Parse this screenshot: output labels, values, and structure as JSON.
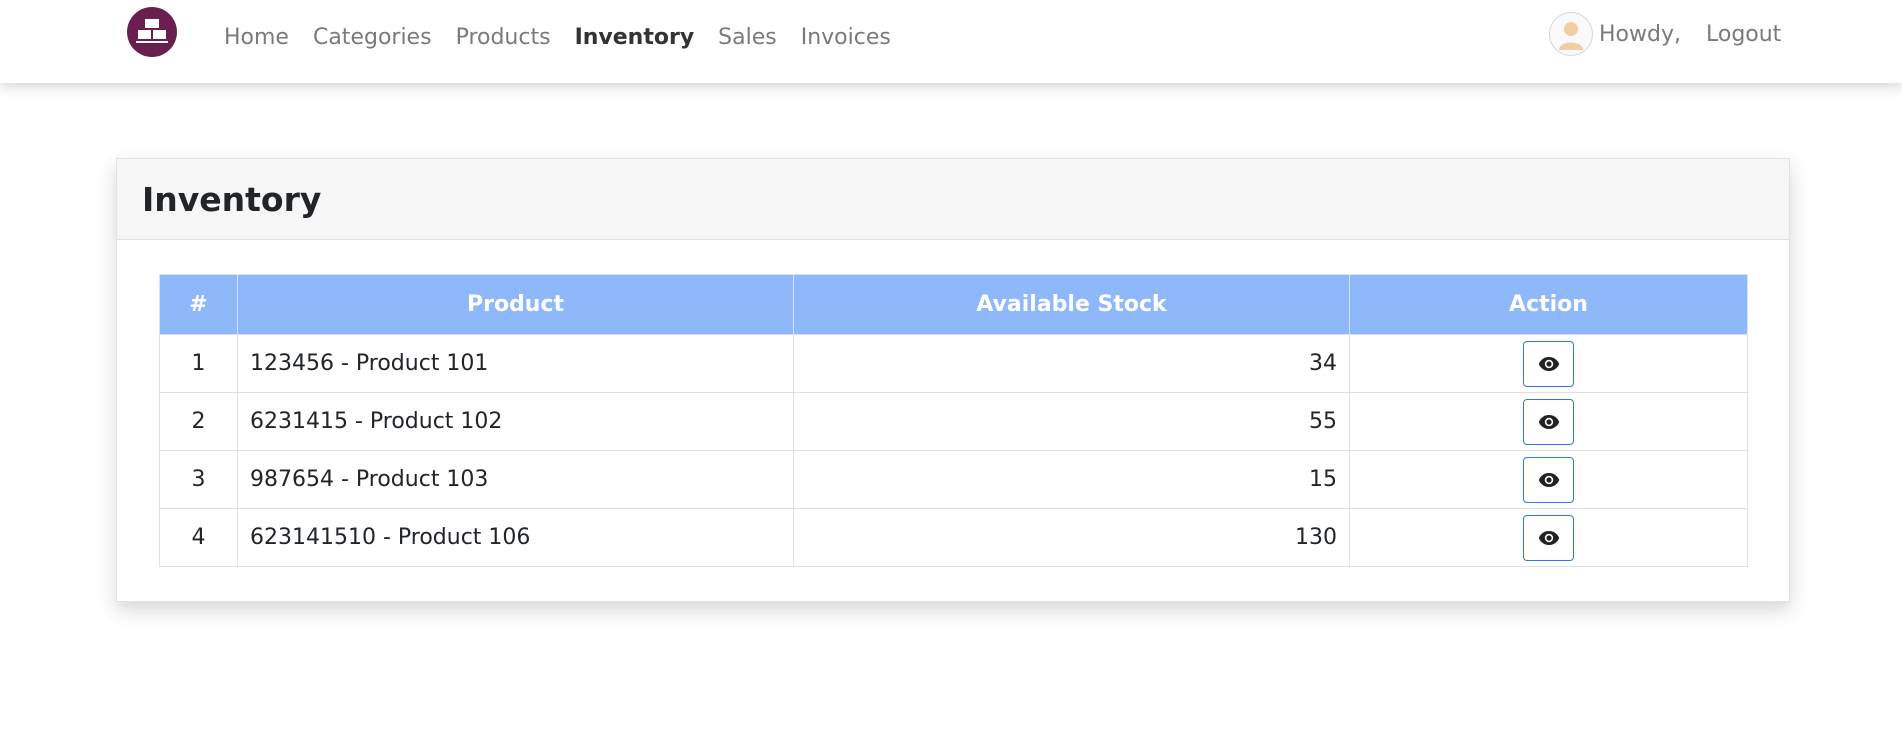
{
  "nav": {
    "brand_logo_icon": "warehouse-boxes-logo",
    "links": [
      {
        "label": "Home",
        "active": false
      },
      {
        "label": "Categories",
        "active": false
      },
      {
        "label": "Products",
        "active": false
      },
      {
        "label": "Inventory",
        "active": true
      },
      {
        "label": "Sales",
        "active": false
      },
      {
        "label": "Invoices",
        "active": false
      }
    ],
    "avatar_icon": "user-avatar-icon",
    "greeting": "Howdy,",
    "logout_label": "Logout"
  },
  "page": {
    "title": "Inventory"
  },
  "table": {
    "headers": [
      "#",
      "Product",
      "Available Stock",
      "Action"
    ],
    "rows": [
      {
        "num": "1",
        "product": "123456 - Product 101",
        "stock": "34",
        "action_icon": "eye-icon"
      },
      {
        "num": "2",
        "product": "6231415 - Product 102",
        "stock": "55",
        "action_icon": "eye-icon"
      },
      {
        "num": "3",
        "product": "987654 - Product 103",
        "stock": "15",
        "action_icon": "eye-icon"
      },
      {
        "num": "4",
        "product": "623141510 - Product 106",
        "stock": "130",
        "action_icon": "eye-icon"
      }
    ]
  },
  "colors": {
    "brand": "#6b1f4f",
    "table_header": "#8fb8fb",
    "button_border": "#2f79e6"
  }
}
